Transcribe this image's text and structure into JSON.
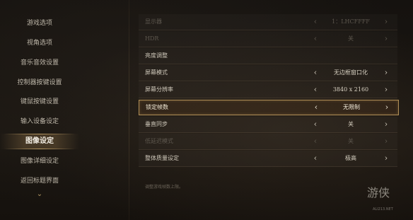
{
  "sidebar": {
    "items": [
      {
        "label": "游戏选项",
        "active": false
      },
      {
        "label": "视角选项",
        "active": false
      },
      {
        "label": "音乐音效设置",
        "active": false
      },
      {
        "label": "控制器按键设置",
        "active": false
      },
      {
        "label": "键鼠按键设置",
        "active": false
      },
      {
        "label": "输入设备设定",
        "active": false
      },
      {
        "label": "图像设定",
        "active": true
      },
      {
        "label": "图像详细设定",
        "active": false
      },
      {
        "label": "返回标题界面",
        "active": false
      }
    ],
    "more_icon": "chevron-down-icon",
    "accent_color": "#b89a64"
  },
  "settings": {
    "rows": [
      {
        "label": "显示器",
        "value": "1：LHCFFFF",
        "dim": true,
        "has_value": true
      },
      {
        "label": "HDR",
        "value": "关",
        "dim": true,
        "has_value": true
      },
      {
        "label": "亮度调整",
        "value": "",
        "dim": false,
        "has_value": false
      },
      {
        "label": "屏幕模式",
        "value": "无边框窗口化",
        "dim": false,
        "has_value": true
      },
      {
        "label": "屏幕分辨率",
        "value": "3840 x 2160",
        "dim": false,
        "has_value": true
      },
      {
        "label": "锁定帧数",
        "value": "无限制",
        "dim": false,
        "has_value": true,
        "selected": true
      },
      {
        "label": "垂直同步",
        "value": "关",
        "dim": false,
        "has_value": true
      },
      {
        "label": "低延迟模式",
        "value": "关",
        "dim": true,
        "has_value": true
      },
      {
        "label": "整体质量设定",
        "value": "极高",
        "dim": false,
        "has_value": true
      }
    ],
    "arrow_left": "‹",
    "arrow_right": "›",
    "selected_color": "#b08e56"
  },
  "hint": "调整游戏帧数上限。",
  "watermark": {
    "text": "游侠",
    "sub": "ALI213.NET"
  }
}
